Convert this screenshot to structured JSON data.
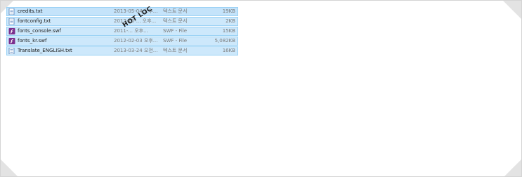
{
  "files": [
    {
      "name": "credits.txt",
      "date": "2013-05-04 오후...",
      "type": "텍스트 문서",
      "size": "19KB",
      "icon": "text-file-icon"
    },
    {
      "name": "fontconfig.txt",
      "date": "2012-10-... 오후...",
      "type": "텍스트 문서",
      "size": "2KB",
      "icon": "text-file-icon"
    },
    {
      "name": "fonts_console.swf",
      "date": "2011-... 오후...",
      "type": "SWF - File",
      "size": "15KB",
      "icon": "swf-file-icon"
    },
    {
      "name": "fonts_kr.swf",
      "date": "2012-02-03 오후...",
      "type": "SWF - File",
      "size": "5,082KB",
      "icon": "swf-file-icon"
    },
    {
      "name": "Translate_ENGLISH.txt",
      "date": "2013-03-24 오전...",
      "type": "텍스트 문서",
      "size": "16KB",
      "icon": "text-file-icon"
    }
  ],
  "watermark": "HOT LOC",
  "colors": {
    "selection_bg": "#cde8fb",
    "selection_border": "#99d1f5",
    "swf_icon": "#7b2f8e",
    "text_icon": "#4a7ab8"
  }
}
